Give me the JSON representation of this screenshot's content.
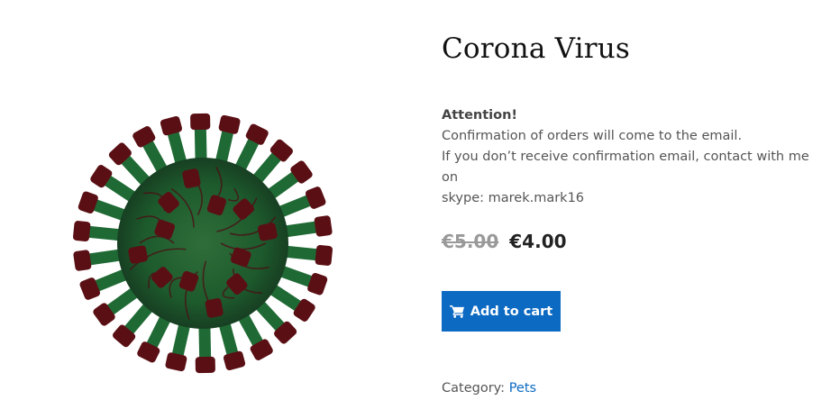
{
  "product": {
    "title": "Corona Virus",
    "image_alt": "coronavirus-image",
    "description": {
      "attention": "Attention!",
      "line1": "Confirmation of orders will come to the email.",
      "line2": "If you don’t receive confirmation email, contact with me on",
      "line3": "skype: marek.mark16"
    },
    "price": {
      "regular": "€5.00",
      "sale": "€4.00"
    },
    "add_to_cart_label": "Add to cart",
    "category_label": "Category:",
    "category_value": "Pets"
  },
  "icons": {
    "cart": "shopping-cart-icon"
  },
  "colors": {
    "accent": "#0c6ac3",
    "virus_body": "#1d5a2c",
    "virus_spike": "#5a0f14"
  }
}
